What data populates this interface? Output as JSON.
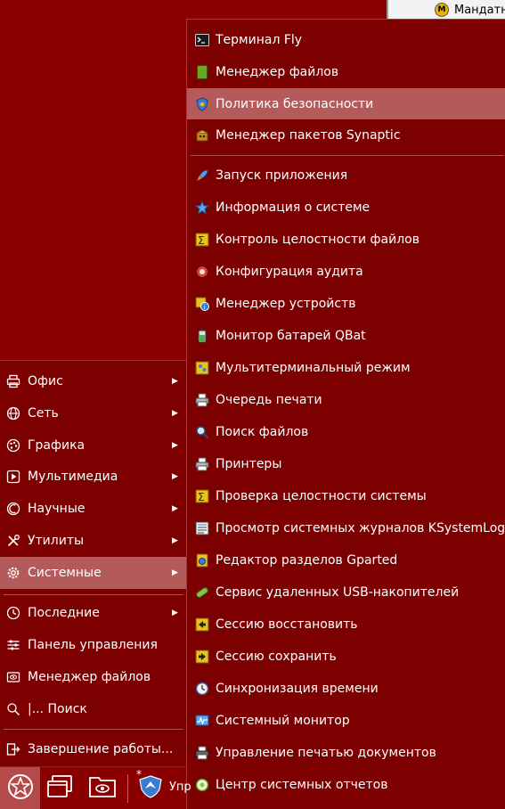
{
  "background_window": {
    "text": "Мандатн"
  },
  "main_menu": {
    "items": [
      {
        "label": "Офис",
        "icon": "printer-icon",
        "has_arrow": true
      },
      {
        "label": "Сеть",
        "icon": "globe-icon",
        "has_arrow": true
      },
      {
        "label": "Графика",
        "icon": "palette-icon",
        "has_arrow": true
      },
      {
        "label": "Мультимедиа",
        "icon": "play-icon",
        "has_arrow": true
      },
      {
        "label": "Научные",
        "icon": "science-icon",
        "has_arrow": true
      },
      {
        "label": "Утилиты",
        "icon": "tools-icon",
        "has_arrow": true
      },
      {
        "label": "Системные",
        "icon": "gear-icon",
        "has_arrow": true,
        "active": true
      }
    ],
    "bottom_items": [
      {
        "label": "Последние",
        "icon": "recent-icon",
        "has_arrow": true
      },
      {
        "label": "Панель управления",
        "icon": "sliders-icon"
      },
      {
        "label": "Менеджер файлов",
        "icon": "file-manager-icon"
      },
      {
        "label": "|... Поиск",
        "icon": "search-icon"
      }
    ],
    "shutdown": {
      "label": "Завершение работы...",
      "icon": "logout-icon"
    },
    "arrow_glyph": "▶"
  },
  "submenu": {
    "group1": [
      {
        "label": "Терминал Fly",
        "icon": "terminal-icon"
      },
      {
        "label": "Менеджер файлов",
        "icon": "file-manager-icon"
      },
      {
        "label": "Политика безопасности",
        "icon": "security-policy-icon",
        "active": true
      },
      {
        "label": "Менеджер пакетов Synaptic",
        "icon": "package-icon"
      }
    ],
    "group2": [
      {
        "label": "Запуск приложения",
        "icon": "rocket-icon"
      },
      {
        "label": "Информация о системе",
        "icon": "star-icon"
      },
      {
        "label": "Контроль целостности файлов",
        "icon": "integrity-icon"
      },
      {
        "label": "Конфигурация аудита",
        "icon": "audit-icon"
      },
      {
        "label": "Менеджер устройств",
        "icon": "device-manager-icon"
      },
      {
        "label": "Монитор батарей QBat",
        "icon": "battery-icon"
      },
      {
        "label": "Мультитерминальный режим",
        "icon": "multiterminal-icon"
      },
      {
        "label": "Очередь печати",
        "icon": "print-queue-icon"
      },
      {
        "label": "Поиск файлов",
        "icon": "search-icon"
      },
      {
        "label": "Принтеры",
        "icon": "printer-icon"
      },
      {
        "label": "Проверка целостности системы",
        "icon": "integrity-icon"
      },
      {
        "label": "Просмотр системных журналов KSystemLog",
        "icon": "log-icon"
      },
      {
        "label": "Редактор разделов Gparted",
        "icon": "disk-icon"
      },
      {
        "label": "Сервис удаленных USB-накопителей",
        "icon": "usb-icon"
      },
      {
        "label": "Сессию восстановить",
        "icon": "session-restore-icon"
      },
      {
        "label": "Сессию сохранить",
        "icon": "session-save-icon"
      },
      {
        "label": "Синхронизация времени",
        "icon": "clock-icon"
      },
      {
        "label": "Системный монитор",
        "icon": "system-monitor-icon"
      },
      {
        "label": "Управление печатью документов",
        "icon": "print-manage-icon"
      },
      {
        "label": "Центр системных отчетов",
        "icon": "report-center-icon"
      }
    ]
  },
  "taskbar": {
    "task_label": "Упр",
    "task_marker": "*"
  },
  "colors": {
    "background": "#8a0000",
    "menu": "#7c0000",
    "highlight": "#b45a5a"
  }
}
